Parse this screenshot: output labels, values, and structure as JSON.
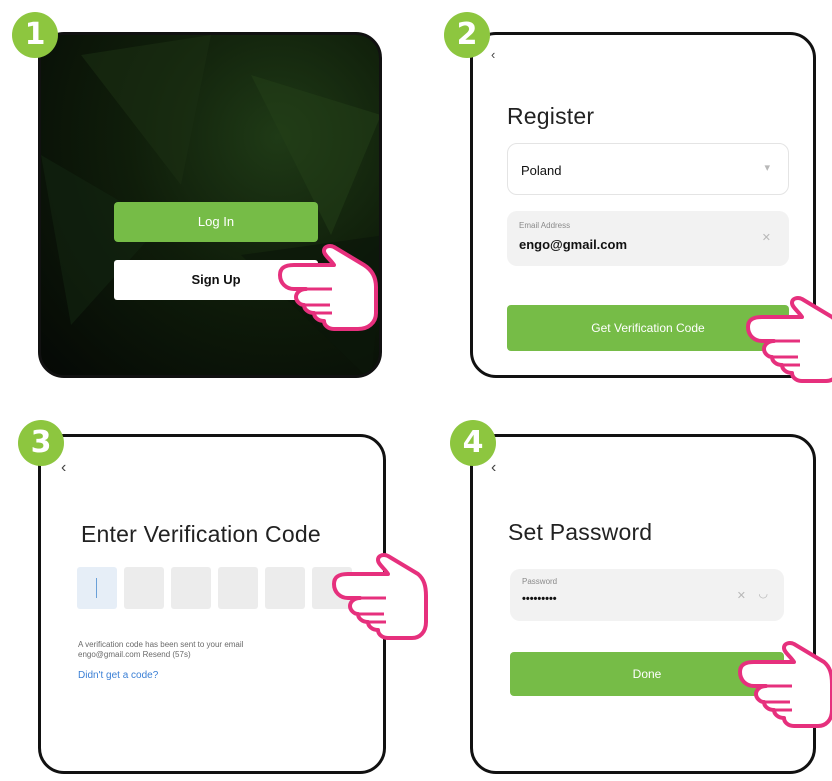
{
  "steps": [
    {
      "number": "1"
    },
    {
      "number": "2"
    },
    {
      "number": "3"
    },
    {
      "number": "4"
    }
  ],
  "step1": {
    "login_label": "Log In",
    "signup_label": "Sign Up"
  },
  "step2": {
    "title": "Register",
    "country": "Poland",
    "email_label": "Email Address",
    "email_value": "engo@gmail.com",
    "button_label": "Get Verification Code"
  },
  "step3": {
    "title": "Enter Verification Code",
    "hint": "A verification code has been sent to your email engo@gmail.com Resend (57s)",
    "link": "Didn't get a code?"
  },
  "step4": {
    "title": "Set Password",
    "password_label": "Password",
    "password_value": "•••••••••",
    "button_label": "Done"
  },
  "colors": {
    "accent_green": "#76bc47",
    "badge_green": "#8dc63f",
    "hand_pink": "#e6307d",
    "link_blue": "#3a7fd5"
  },
  "icons": [
    "chevron-down-icon",
    "clear-icon",
    "back-chevron-icon",
    "eye-hidden-icon",
    "pointing-hand-icon"
  ]
}
